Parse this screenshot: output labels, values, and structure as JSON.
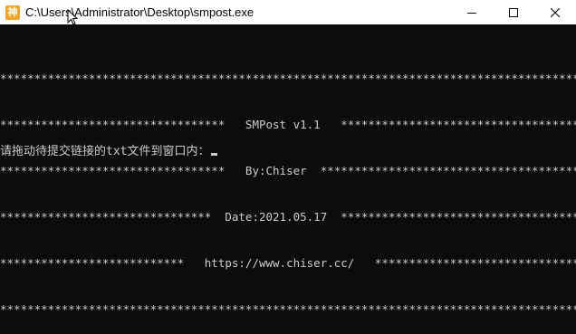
{
  "window": {
    "app_icon_glyph": "神",
    "title": "C:\\Users\\Administrator\\Desktop\\smpost.exe",
    "icons": {
      "minimize": "minimize-icon",
      "maximize": "maximize-icon",
      "close": "close-icon"
    }
  },
  "console": {
    "lines": [
      "****************************************************************************************************",
      "*********************************   SMPost v1.1   ***************************************************",
      "*********************************   By:Chiser  *****************************************************",
      "*******************************  Date:2021.05.17  **************************************************",
      "***************************   https://www.chiser.cc/   *********************************************",
      "****************************************************************************************************"
    ],
    "prompt": "请拖动待提交链接的txt文件到窗口内："
  },
  "colors": {
    "background": "#0c0c0c",
    "text": "#cccccc",
    "titlebar": "#ffffff",
    "icon_accent": "#f5a623"
  }
}
